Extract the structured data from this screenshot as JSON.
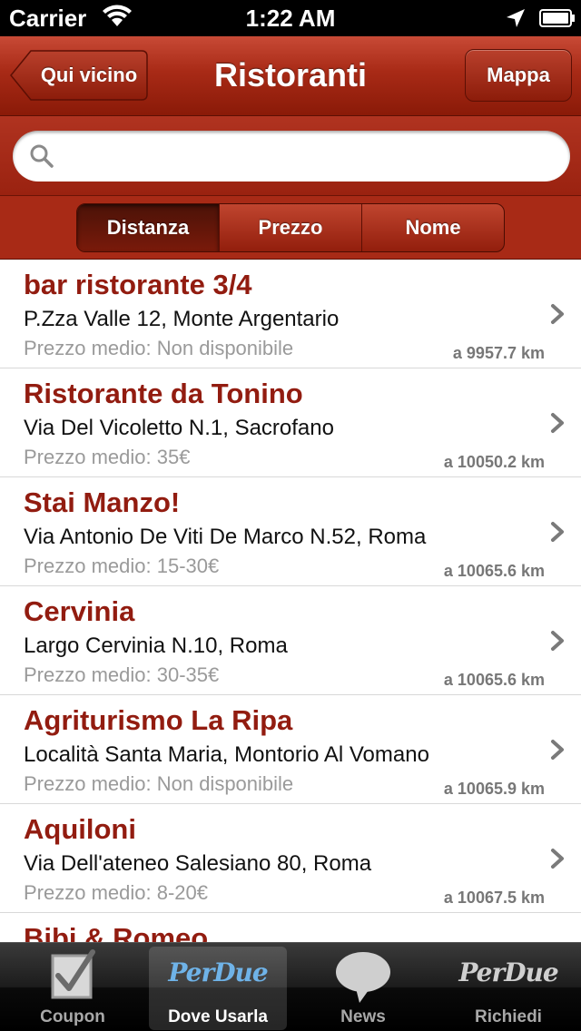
{
  "status_bar": {
    "carrier": "Carrier",
    "time": "1:22 AM"
  },
  "nav": {
    "title": "Ristoranti",
    "back_label": "Qui vicino",
    "map_label": "Mappa"
  },
  "search": {
    "placeholder": "",
    "value": ""
  },
  "segments": [
    {
      "label": "Distanza",
      "active": true
    },
    {
      "label": "Prezzo",
      "active": false
    },
    {
      "label": "Nome",
      "active": false
    }
  ],
  "restaurants": [
    {
      "name": "bar ristorante 3/4",
      "address": "P.Zza Valle 12, Monte Argentario",
      "price": "Prezzo medio: Non disponibile",
      "distance": "a 9957.7 km"
    },
    {
      "name": "Ristorante da Tonino",
      "address": "Via Del Vicoletto N.1, Sacrofano",
      "price": "Prezzo medio: 35€",
      "distance": "a 10050.2 km"
    },
    {
      "name": "Stai Manzo!",
      "address": "Via Antonio De Viti De Marco N.52, Roma",
      "price": "Prezzo medio: 15-30€",
      "distance": "a 10065.6 km"
    },
    {
      "name": "Cervinia",
      "address": "Largo Cervinia N.10, Roma",
      "price": "Prezzo medio: 30-35€",
      "distance": "a 10065.6 km"
    },
    {
      "name": "Agriturismo La Ripa",
      "address": "Località Santa Maria, Montorio Al Vomano",
      "price": "Prezzo medio: Non disponibile",
      "distance": "a 10065.9 km"
    },
    {
      "name": "Aquiloni",
      "address": "Via Dell'ateneo Salesiano 80, Roma",
      "price": "Prezzo medio: 8-20€",
      "distance": "a 10067.5 km"
    },
    {
      "name": "Bibi & Romeo",
      "address": "",
      "price": "",
      "distance": ""
    }
  ],
  "tabs": [
    {
      "label": "Coupon",
      "icon": "checkbox-icon",
      "active": false
    },
    {
      "label": "Dove Usarla",
      "icon": "perdue-logo-icon",
      "logo_text": "PerDue",
      "active": true
    },
    {
      "label": "News",
      "icon": "speech-bubble-icon",
      "active": false
    },
    {
      "label": "Richiedi",
      "icon": "perdue-logo-icon",
      "logo_text": "PerDue",
      "active": false
    }
  ],
  "colors": {
    "brand_red": "#a82a16",
    "restaurant_name": "#921c10"
  }
}
